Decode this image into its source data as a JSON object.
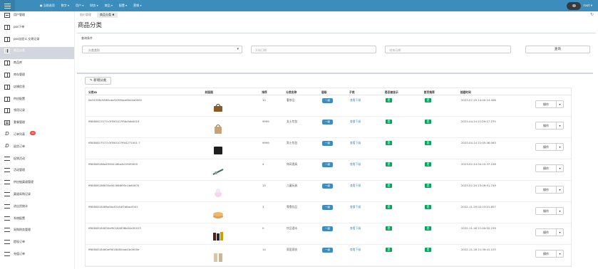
{
  "topbar": {
    "brand": "● 当前选项",
    "menus": [
      "数字 ▾",
      "用户 ▾",
      "财务 ▾",
      "商品 ▾",
      "配置 ▾",
      "营销 ▾"
    ],
    "user": "root ▾",
    "accent": "#3c8dbc"
  },
  "sidebar": {
    "items": [
      {
        "label": "用户管理",
        "icon": "doc-icon"
      },
      {
        "label": "pos下单",
        "icon": "table-icon"
      },
      {
        "label": "pos自定义 交易记录",
        "icon": "table-icon"
      },
      {
        "label": "商品分类",
        "icon": "table-icon",
        "active": true
      },
      {
        "label": "商品库",
        "icon": "table-icon"
      },
      {
        "label": "库存管理",
        "icon": "table-icon"
      },
      {
        "label": "店铺信息",
        "icon": "table-icon"
      },
      {
        "label": "供应配置",
        "icon": "table-icon"
      },
      {
        "label": "领用记录",
        "icon": "table-icon"
      },
      {
        "label": "套餐管理",
        "icon": "list-icon"
      },
      {
        "label": "订单列表",
        "icon": "italic-icon",
        "badge": "44"
      },
      {
        "label": "退货订单",
        "icon": "italic-icon"
      },
      {
        "label": "促销活动",
        "icon": "card-icon"
      },
      {
        "label": "活动管理",
        "icon": "card-icon"
      },
      {
        "label": "供应链渠道管理",
        "icon": "card-icon"
      },
      {
        "label": "渠道采购记录",
        "icon": "card-icon"
      },
      {
        "label": "进出货统计",
        "icon": "card-icon"
      },
      {
        "label": "系统配置",
        "icon": "card-icon"
      },
      {
        "label": "采购财务管理",
        "icon": "card-icon"
      },
      {
        "label": "提现订单",
        "icon": "card-icon"
      },
      {
        "label": "充值订单",
        "icon": "card-icon"
      }
    ]
  },
  "tabs": [
    {
      "label": "报价管理"
    },
    {
      "label": "商品分类 ✖",
      "active": true
    }
  ],
  "page_title": "商品分类",
  "search": {
    "heading": "查询条件",
    "category_placeholder": "分类类别",
    "start_placeholder": "开始日期",
    "end_placeholder": "结束日期",
    "query_label": "查询"
  },
  "add_label": "✎ 新增分类",
  "table": {
    "headers": [
      "分类ID",
      "封面图",
      "排序",
      "分类名称",
      "层级",
      "子类",
      "是否被显示",
      "首页推荐",
      "创建时间",
      ""
    ],
    "rows": [
      {
        "id": "0b34306c5898cdaf1059bce80d4a0000",
        "sort": "10",
        "name": "奢侈品",
        "level": "一级",
        "child": "查看下级",
        "time": "2023-07-19 14:40:14.408",
        "thumb": "bag-brown"
      },
      {
        "id": "ff8080817077c3f590107ff4b5db0019",
        "sort": "9999",
        "name": "女士包包",
        "level": "一级",
        "child": "查看下级",
        "time": "2023-04-14 21:29:17.275",
        "thumb": "bag-tan"
      },
      {
        "id": "ff8080817077c3f590107ff44271001 7",
        "sort": "9999",
        "name": "男士包包",
        "level": "一级",
        "child": "查看下级",
        "time": "2023-04-14 21:05:46.063",
        "thumb": "bag-black"
      },
      {
        "id": "ff80808186a45900186a4b190f0000",
        "sort": "4",
        "name": "休闲渔具",
        "level": "一级",
        "child": "查看下级",
        "time": "2023-02-24 04:10:37.228",
        "thumb": "fishing-rod"
      },
      {
        "id": "ff80808186635a901866f95c1b60005",
        "sort": "15",
        "name": "儿童玩具",
        "level": "一级",
        "child": "查看下级",
        "time": "2023-02-20 23:09:51.749",
        "thumb": "toy"
      },
      {
        "id": "ff8080818486e5bcf0184f7d6ac0002",
        "sort": "3",
        "name": "零食饮品",
        "level": "一级",
        "child": "查看下级",
        "time": "2022-11-29 02:23:01.857",
        "thumb": "cake"
      },
      {
        "id": "ff80808184830ef90184836b04a30013",
        "sort": "0",
        "name": "饮品酒水",
        "level": "一级",
        "child": "查看下级",
        "time": "2022-11-18 21:40:02.239",
        "thumb": "bottles"
      },
      {
        "id": "ff8080818480ef90184804ab1b0000e",
        "sort": "14",
        "name": "家居家纺",
        "level": "一级",
        "child": "查看下级",
        "time": "2022-11-18 21:39:41.103",
        "thumb": "curtain"
      }
    ],
    "op_label": "操作",
    "op_caret": "▾",
    "ok_glyph": "是"
  }
}
